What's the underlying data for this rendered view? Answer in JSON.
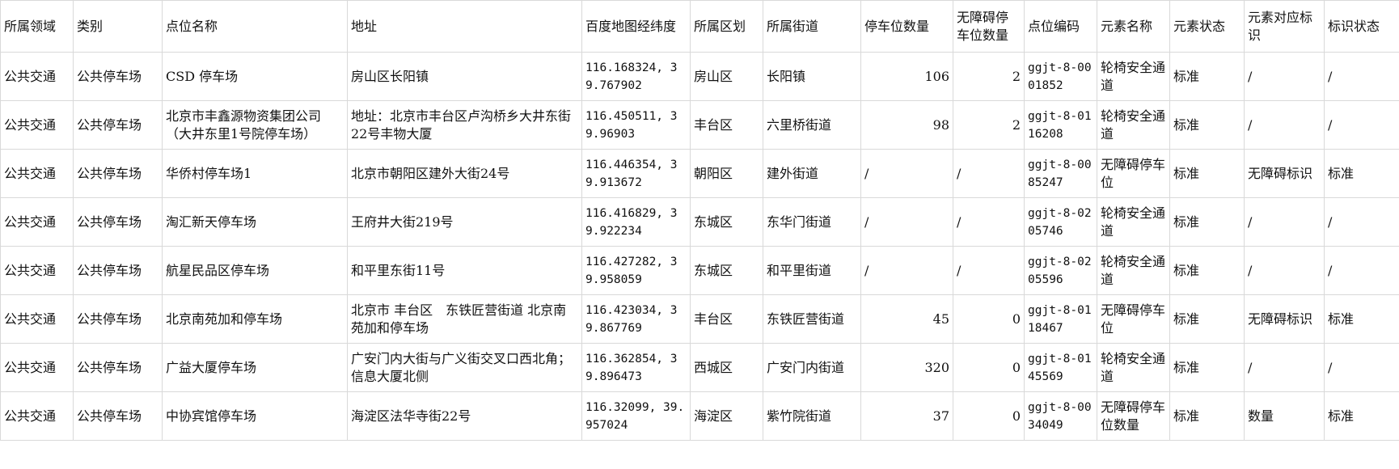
{
  "headers": [
    "所属领域",
    "类别",
    "点位名称",
    "地址",
    "百度地图经纬度",
    "所属区划",
    "所属街道",
    "停车位数量",
    "无障碍停车位数量",
    "点位编码",
    "元素名称",
    "元素状态",
    "元素对应标识",
    "标识状态"
  ],
  "rows": [
    [
      "公共交通",
      "公共停车场",
      "CSD 停车场",
      "房山区长阳镇",
      "116.168324, 39.767902",
      "房山区",
      "长阳镇",
      "106",
      "2",
      "ggjt-8-0001852",
      "轮椅安全通道",
      "标准",
      "/",
      "/"
    ],
    [
      "公共交通",
      "公共停车场",
      "北京市丰鑫源物资集团公司（大井东里1号院停车场）",
      "地址：北京市丰台区卢沟桥乡大井东街22号丰物大厦",
      "116.450511, 39.96903",
      "丰台区",
      "六里桥街道",
      "98",
      "2",
      "ggjt-8-0116208",
      "轮椅安全通道",
      "标准",
      "/",
      "/"
    ],
    [
      "公共交通",
      "公共停车场",
      "华侨村停车场1",
      "北京市朝阳区建外大街24号",
      "116.446354, 39.913672",
      "朝阳区",
      "建外街道",
      "/",
      "/",
      "ggjt-8-0085247",
      "无障碍停车位",
      "标准",
      "无障碍标识",
      "标准"
    ],
    [
      "公共交通",
      "公共停车场",
      "淘汇新天停车场",
      "王府井大街219号",
      "116.416829, 39.922234",
      "东城区",
      "东华门街道",
      "/",
      "/",
      "ggjt-8-0205746",
      "轮椅安全通道",
      "标准",
      "/",
      "/"
    ],
    [
      "公共交通",
      "公共停车场",
      "航星民品区停车场",
      "和平里东街11号",
      "116.427282, 39.958059",
      "东城区",
      "和平里街道",
      "/",
      "/",
      "ggjt-8-0205596",
      "轮椅安全通道",
      "标准",
      "/",
      "/"
    ],
    [
      "公共交通",
      "公共停车场",
      "北京南苑加和停车场",
      "北京市 丰台区　东铁匠营街道 北京南苑加和停车场",
      "116.423034, 39.867769",
      "丰台区",
      "东铁匠营街道",
      "45",
      "0",
      "ggjt-8-0118467",
      "无障碍停车位",
      "标准",
      "无障碍标识",
      "标准"
    ],
    [
      "公共交通",
      "公共停车场",
      "广益大厦停车场",
      "广安门内大街与广义街交叉口西北角；信息大厦北侧",
      "116.362854, 39.896473",
      "西城区",
      "广安门内街道",
      "320",
      "0",
      "ggjt-8-0145569",
      "轮椅安全通道",
      "标准",
      "/",
      "/"
    ],
    [
      "公共交通",
      "公共停车场",
      "中协宾馆停车场",
      "海淀区法华寺街22号",
      "116.32099, 39.957024",
      "海淀区",
      "紫竹院街道",
      "37",
      "0",
      "ggjt-8-0034049",
      "无障碍停车位数量",
      "标准",
      "数量",
      "标准"
    ]
  ]
}
